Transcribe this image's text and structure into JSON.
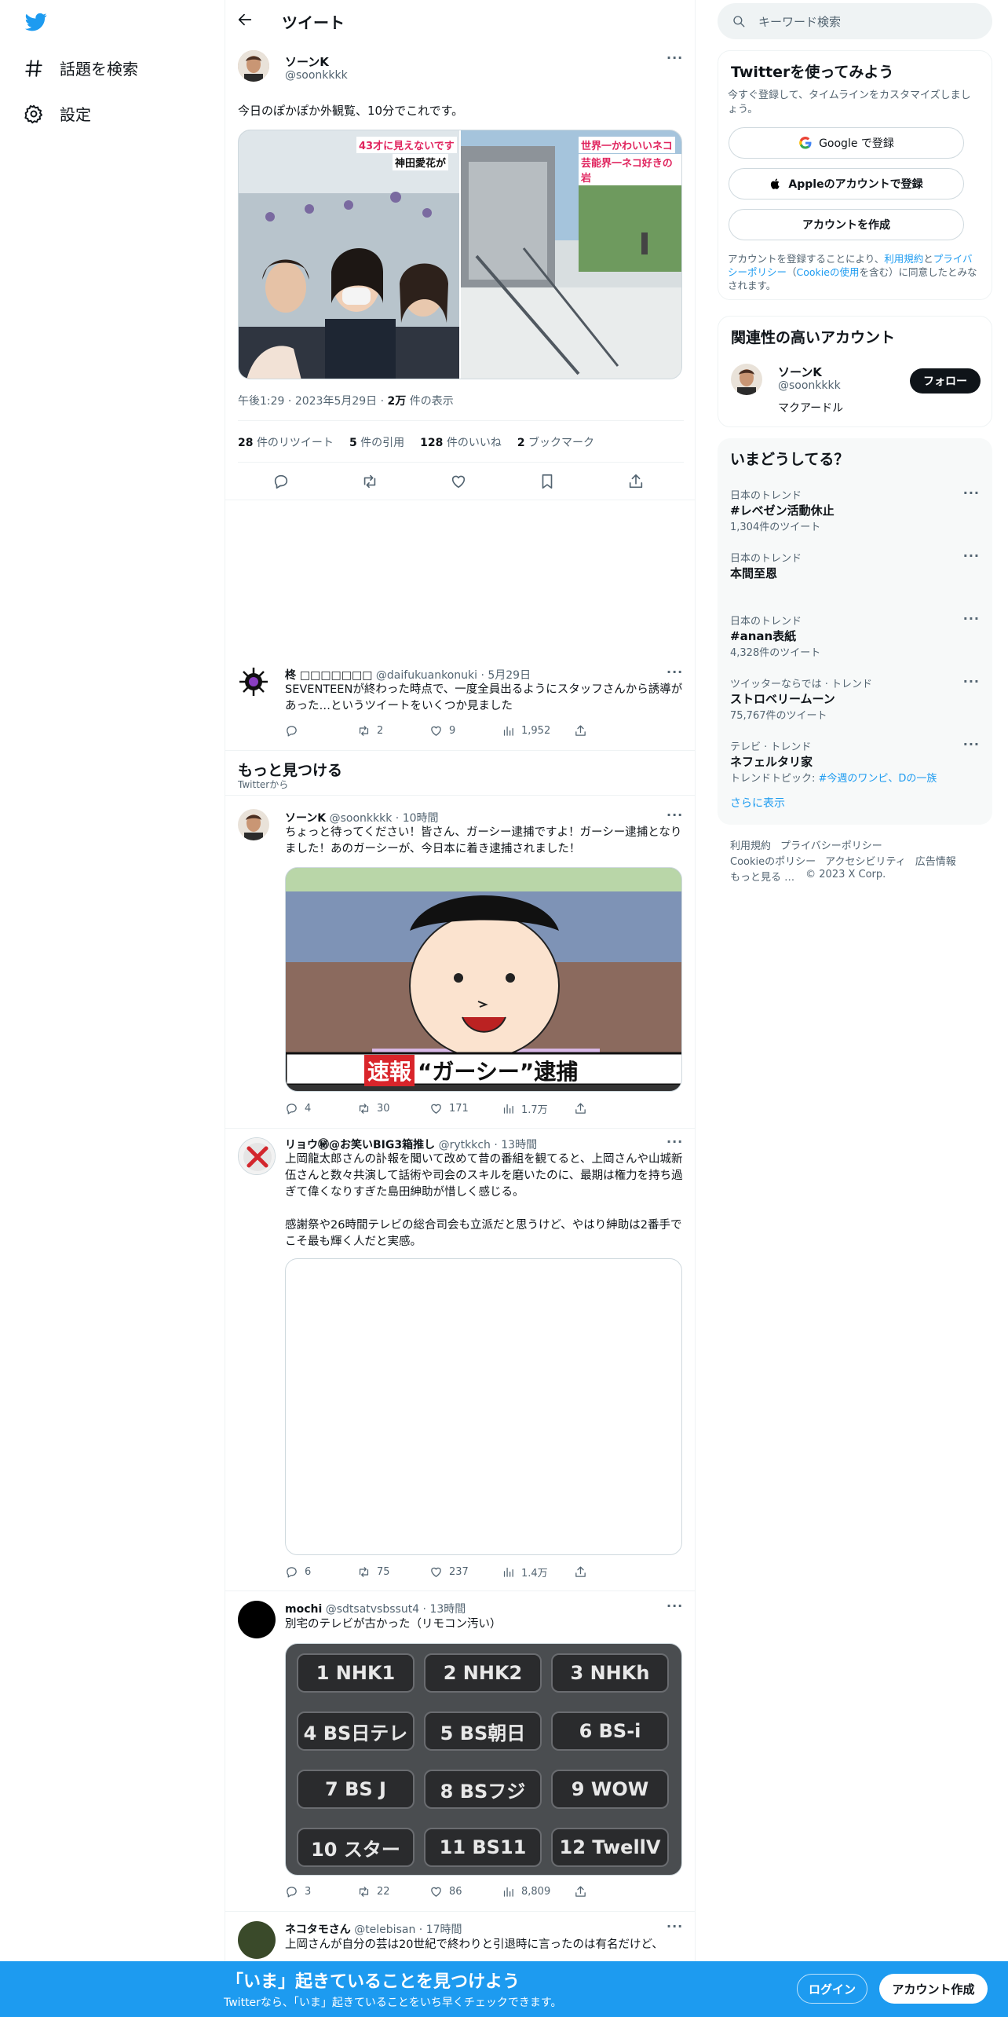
{
  "nav": {
    "items": [
      {
        "label": "話題を検索",
        "icon": "hashtag-icon"
      },
      {
        "label": "設定",
        "icon": "gear-icon"
      }
    ]
  },
  "header": {
    "title": "ツイート"
  },
  "main_tweet": {
    "name": "ソーンK",
    "handle": "@soonkkkk",
    "text": "今日のぽかぽか外観覧、10分でこれです。",
    "photo_captions": [
      "43才に見えないです",
      "神田愛花が",
      "世界一かわいいネコ",
      "芸能界一ネコ好きの岩"
    ],
    "time": "午後1:29",
    "date": "2023年5月29日",
    "views_num": "2万",
    "views_label": "件の表示",
    "stats": [
      {
        "num": "28",
        "label": "件のリツイート"
      },
      {
        "num": "5",
        "label": "件の引用"
      },
      {
        "num": "128",
        "label": "件のいいね"
      },
      {
        "num": "2",
        "label": "ブックマーク"
      }
    ]
  },
  "reply": {
    "name": "柊 □□□□□□□",
    "handle": "@daifukuankonuki",
    "time": "5月29日",
    "text": "SEVENTEENが終わった時点で、一度全員出るようにスタッフさんから誘導があった…というツイートをいくつか見ました",
    "counts": {
      "reply": "",
      "retweet": "2",
      "like": "9",
      "views": "1,952"
    }
  },
  "discover": {
    "title": "もっと見つける",
    "subtitle": "Twitterから"
  },
  "feed": [
    {
      "name": "ソーンK",
      "handle": "@soonkkkk",
      "time": "10時間",
      "text": "ちょっと待ってください！皆さん、ガーシー逮捕ですよ！ガーシー逮捕となりました！あのガーシーが、今日本に着き逮捕されました！",
      "image_caption_tag": "速報",
      "image_caption": "“ガーシー”逮捕",
      "counts": {
        "reply": "4",
        "retweet": "30",
        "like": "171",
        "views": "1.7万"
      }
    },
    {
      "name": "リョウ㊙@お笑いBIG3箱推し",
      "handle": "@rytkkch",
      "time": "13時間",
      "text": "上岡龍太郎さんの訃報を聞いて改めて昔の番組を観てると、上岡さんや山城新伍さんと数々共演して話術や司会のスキルを磨いたのに、最期は権力を持ち過ぎて偉くなりすぎた島田紳助が惜しく感じる。",
      "text2": "感謝祭や26時間テレビの総合司会も立派だと思うけど、やはり紳助は2番手でこそ最も輝く人だと実感。",
      "counts": {
        "reply": "6",
        "retweet": "75",
        "like": "237",
        "views": "1.4万"
      }
    },
    {
      "name": "mochi",
      "handle": "@sdtsatvsbssut4",
      "time": "13時間",
      "text": "別宅のテレビが古かった（リモコン汚い）",
      "remote_keys": [
        "1 NHK1",
        "2 NHK2",
        "3 NHKh",
        "4 BS日テレ",
        "5 BS朝日",
        "6 BS-i",
        "7 BS J",
        "8 BSフジ",
        "9 WOW",
        "10 スター",
        "11 BS11",
        "12 TwellV"
      ],
      "counts": {
        "reply": "3",
        "retweet": "22",
        "like": "86",
        "views": "8,809"
      }
    },
    {
      "name": "ネコタモさん",
      "handle": "@telebisan",
      "time": "17時間",
      "text": "上岡さんが自分の芸は20世紀で終わりと引退時に言ったのは有名だけど、"
    }
  ],
  "search": {
    "placeholder": "キーワード検索"
  },
  "signup": {
    "title": "Twitterを使ってみよう",
    "desc": "今すぐ登録して、タイムラインをカスタマイズしましょう。",
    "google": "Google で登録",
    "apple": "Appleのアカウントで登録",
    "create": "アカウントを作成",
    "legal_1": "アカウントを登録することにより、",
    "terms": "利用規約",
    "and": "と",
    "privacy": "プライバシーポリシー",
    "cookie": "Cookieの使用",
    "legal_2": "を含む）に同意したとみなされます。",
    "paren": "（"
  },
  "related": {
    "title": "関連性の高いアカウント",
    "name": "ソーンK",
    "handle": "@soonkkkk",
    "bio": "マクアードル",
    "follow": "フォロー"
  },
  "trends": {
    "title": "いまどうしてる？",
    "items": [
      {
        "context": "日本のトレンド",
        "name": "#レベゼン活動休止",
        "count": "1,304件のツイート"
      },
      {
        "context": "日本のトレンド",
        "name": "本間至恩",
        "count": ""
      },
      {
        "context": "日本のトレンド",
        "name": "#anan表紙",
        "count": "4,328件のツイート"
      },
      {
        "context": "ツイッターならでは · トレンド",
        "name": "ストロベリームーン",
        "count": "75,767件のツイート"
      },
      {
        "context": "テレビ · トレンド",
        "name": "ネフェルタリ家",
        "count": "トレンドトピック: ",
        "links": "#今週のワンピ、Dの一族"
      }
    ],
    "show_more": "さらに表示"
  },
  "footer": {
    "line1": [
      "利用規約",
      "プライバシーポリシー"
    ],
    "line2": [
      "Cookieのポリシー",
      "アクセシビリティ",
      "広告情報"
    ],
    "line3": [
      "もっと見る …",
      "© 2023 X Corp."
    ]
  },
  "banner": {
    "title": "「いま」起きていることを見つけよう",
    "subtitle": "Twitterなら、「いま」起きていることをいち早くチェックできます。",
    "login": "ログイン",
    "signup": "アカウント作成"
  },
  "colors": {
    "accent": "#1d9bf0",
    "text": "#0f1419",
    "secondary": "#536471",
    "live": "#e0245e"
  }
}
